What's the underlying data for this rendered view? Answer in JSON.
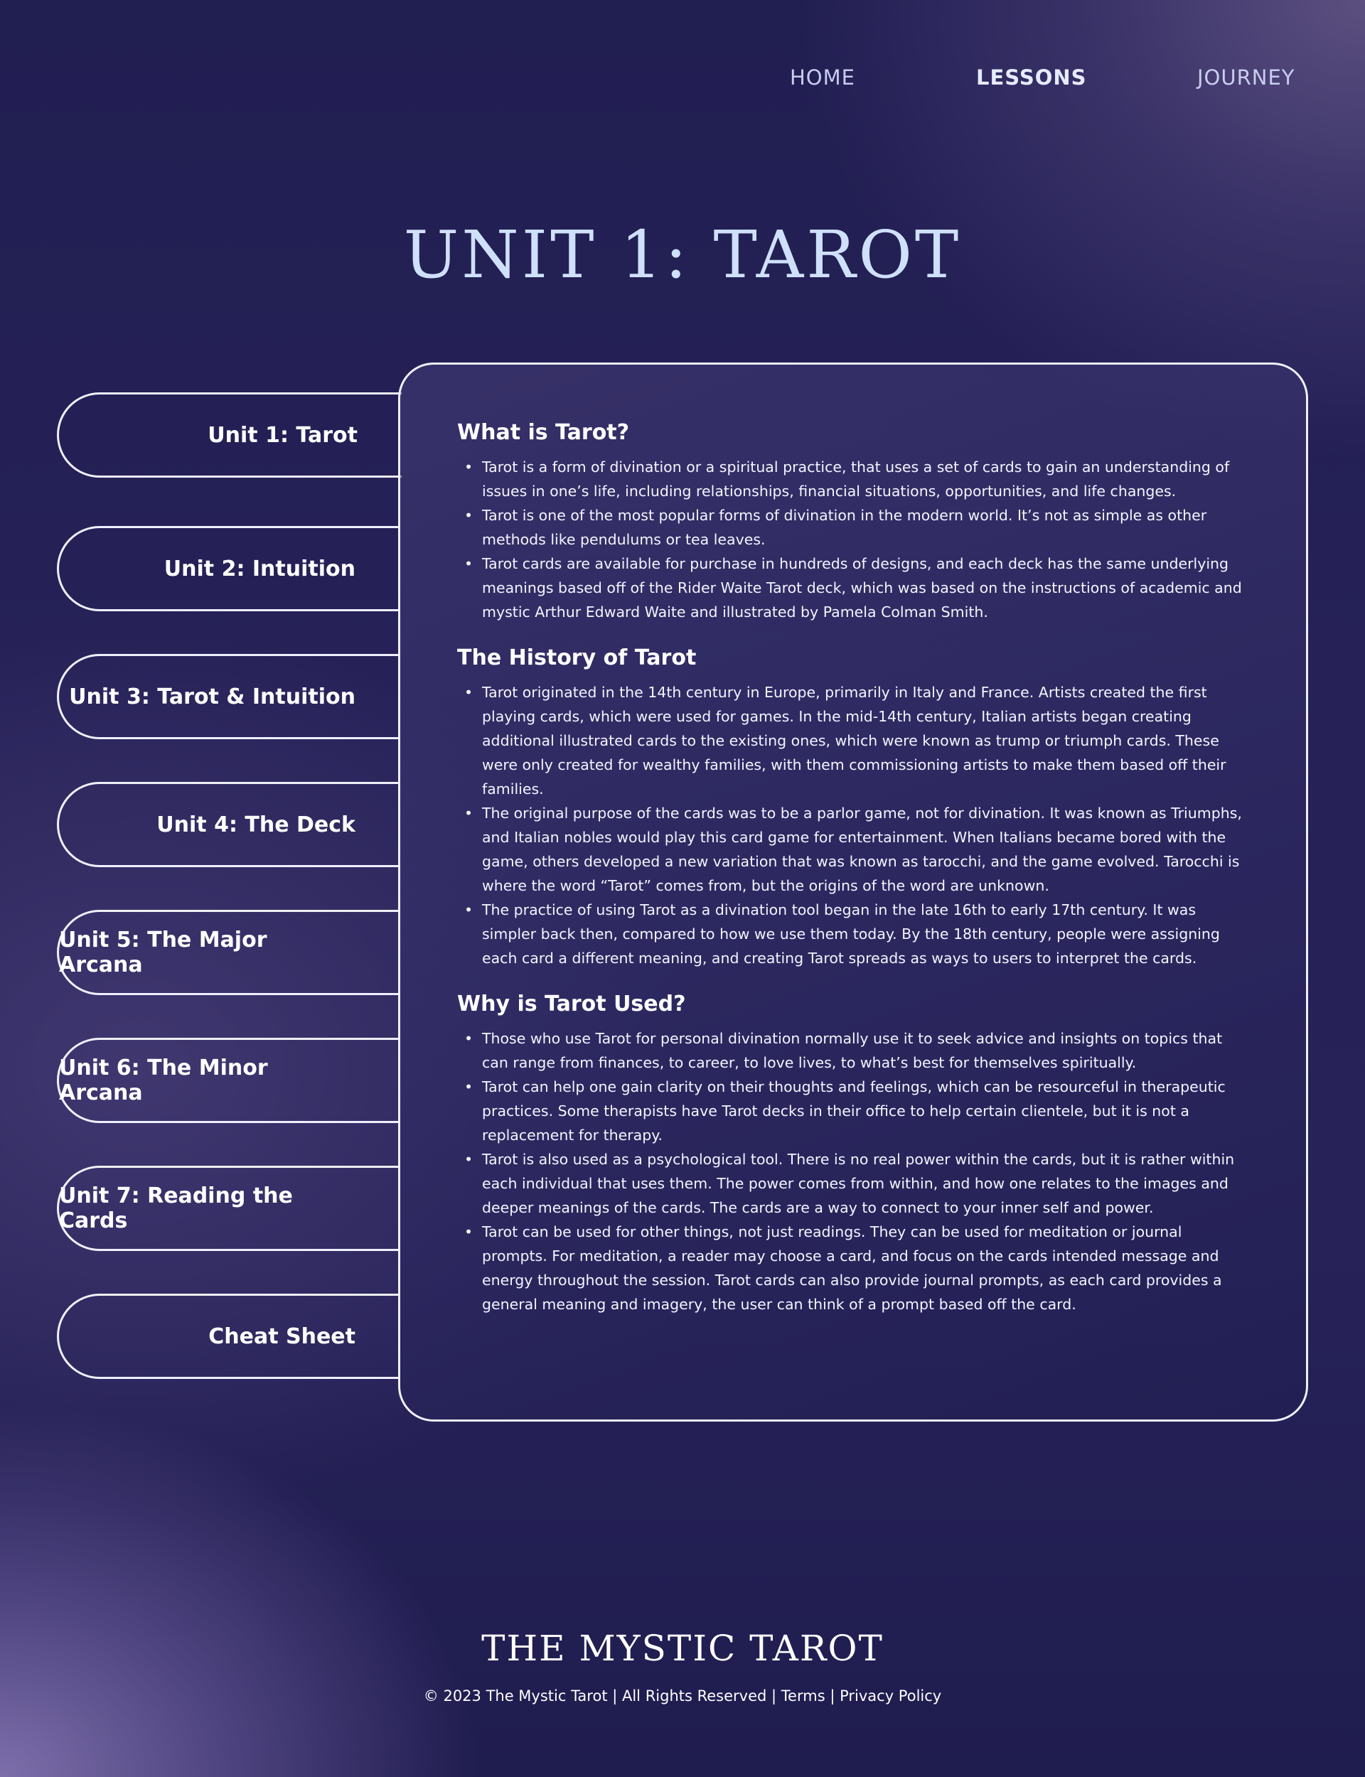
{
  "nav": {
    "home": "HOME",
    "lessons": "LESSONS",
    "journey": "JOURNEY"
  },
  "page_title": "UNIT 1: TAROT",
  "tabs": [
    {
      "label": "Unit 1: Tarot",
      "active": true
    },
    {
      "label": "Unit 2: Intuition"
    },
    {
      "label": "Unit 3: Tarot & Intuition"
    },
    {
      "label": "Unit 4: The Deck"
    },
    {
      "label": "Unit 5: The Major Arcana"
    },
    {
      "label": "Unit 6: The Minor Arcana"
    },
    {
      "label": "Unit 7: Reading the Cards"
    },
    {
      "label": "Cheat Sheet"
    }
  ],
  "sections": [
    {
      "heading": "What is Tarot?",
      "bullets": [
        "Tarot is a form of divination or a spiritual practice, that uses a set of cards to gain an understanding of issues in one’s life, including relationships, financial situations, opportunities, and life changes.",
        "Tarot is one of the most popular forms of divination in the modern world. It’s not as simple as other methods like pendulums or tea leaves.",
        "Tarot cards are available for purchase in hundreds of designs, and each deck has the same underlying meanings based off of the Rider Waite Tarot deck, which was based on the instructions of academic and mystic Arthur Edward Waite and illustrated by Pamela Colman Smith."
      ]
    },
    {
      "heading": "The History of Tarot",
      "bullets": [
        "Tarot originated in the 14th century in Europe, primarily in Italy and France. Artists created the first playing cards, which were used for games. In the mid-14th century, Italian artists began creating additional illustrated cards to the existing ones, which were known as trump or triumph cards. These were only created for wealthy families, with them commissioning artists to make them based off their families.",
        "The original purpose of the cards was to be a parlor game, not for divination. It was known as Triumphs, and Italian nobles would play this card game for entertainment. When Italians became bored with the game, others developed a new variation that was known as tarocchi, and the game evolved. Tarocchi is where the word “Tarot” comes from, but the origins of the word are unknown.",
        "The practice of using Tarot as a divination tool began in the late 16th to early 17th century. It was simpler back then, compared to how we use them today. By the 18th century, people were assigning each card a different meaning, and creating Tarot spreads as ways to users to interpret the cards."
      ]
    },
    {
      "heading": "Why is Tarot Used?",
      "bullets": [
        "Those who use Tarot for personal divination normally use it to seek advice and insights on topics that can range from finances, to career, to love lives, to what’s best for themselves spiritually.",
        "Tarot can help one gain clarity on their thoughts and feelings, which can be resourceful in therapeutic practices. Some therapists have Tarot decks in their office to help certain clientele, but it is not a replacement for therapy.",
        "Tarot is also used as a psychological tool. There is no real power within the cards, but it is rather within each individual that uses them. The power comes from within, and how one relates to the images and deeper meanings of the cards. The cards are a way to connect to your inner self and power.",
        "Tarot can be used for other things, not just readings. They can be used for meditation or journal prompts. For meditation, a reader may choose a card, and focus on the cards intended message and energy throughout the session. Tarot cards can also provide journal prompts, as each card provides a general meaning and imagery, the user can think of a prompt based off the card."
      ]
    }
  ],
  "footer": {
    "logo": "THE MYSTIC TAROT",
    "copyright": "© 2023 The Mystic Tarot | All Rights Reserved |",
    "terms": "Terms",
    "separator": "|",
    "privacy": "Privacy Policy"
  },
  "colors": {
    "title": "#cfe0fb",
    "nav": "#c9cdf0",
    "border": "#eef0ff"
  }
}
